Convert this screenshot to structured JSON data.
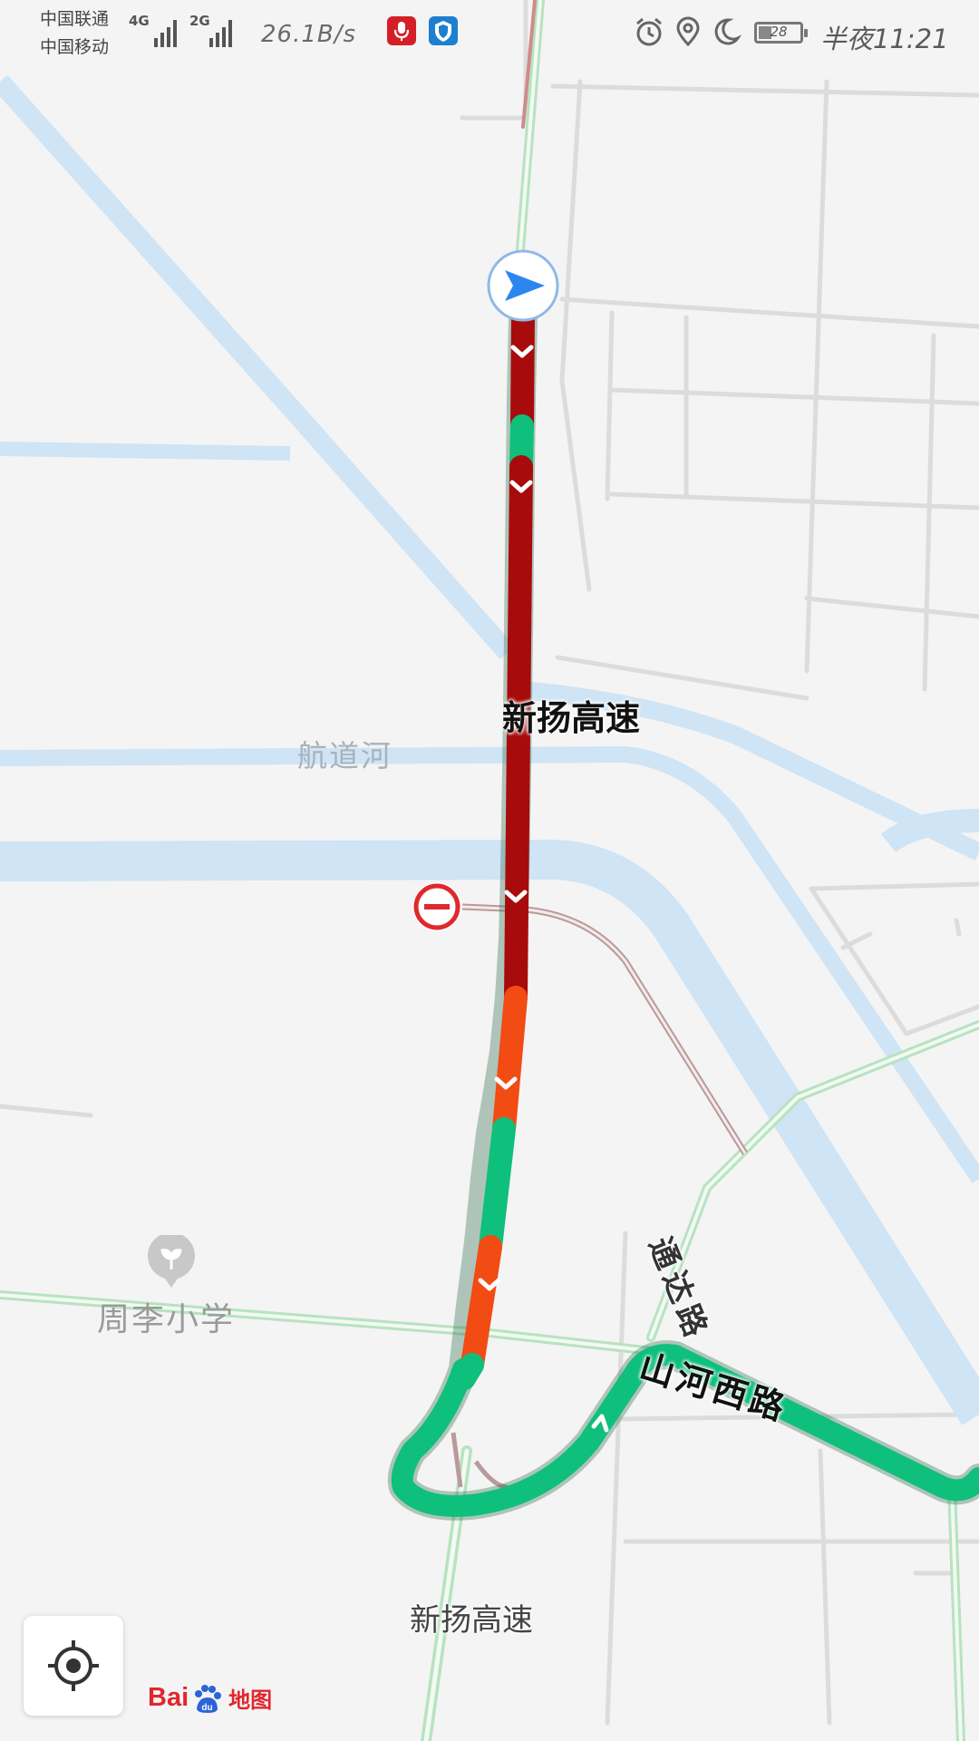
{
  "status_bar": {
    "carrier_1": "中国联通",
    "carrier_2": "中国移动",
    "network_1": "4G",
    "network_2": "2G",
    "net_speed": "26.1B/s",
    "battery_level": "28",
    "time": "半夜11:21",
    "icons": [
      "mic-app-icon",
      "shield-app-icon",
      "alarm-icon",
      "location-icon",
      "moon-icon",
      "battery-icon"
    ]
  },
  "map": {
    "road_labels": {
      "xinyang_highway": "新扬高速",
      "xinyang_highway_south": "新扬高速",
      "tongda_road": "通达路",
      "shanhe_west_road": "山河西路"
    },
    "river_label": "航道河",
    "poi": {
      "name": "周李小学",
      "icon": "school-pin-icon"
    },
    "traffic_colors": {
      "severe": "#a80b0b",
      "slow": "#f24b13",
      "smooth": "#0fbf7c"
    },
    "route_warning_icon": "no-entry-icon",
    "location_marker_icon": "navigation-arrow-icon"
  },
  "controls": {
    "locate_button_icon": "locate-crosshair-icon"
  },
  "brand": {
    "logo_left": "Bai",
    "logo_right": "地图",
    "logo_mark": "du"
  }
}
